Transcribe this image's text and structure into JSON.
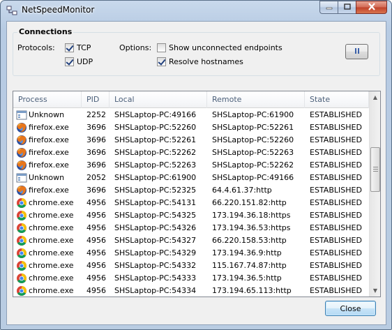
{
  "window": {
    "title": "NetSpeedMonitor"
  },
  "connections": {
    "group_title": "Connections",
    "protocols_label": "Protocols:",
    "tcp": {
      "label": "TCP",
      "checked": true
    },
    "udp": {
      "label": "UDP",
      "checked": true
    },
    "options_label": "Options:",
    "show_unconnected": {
      "label": "Show unconnected endpoints",
      "checked": false
    },
    "resolve_hostnames": {
      "label": "Resolve hostnames",
      "checked": true
    },
    "pause_icon": "pause-icon"
  },
  "table": {
    "columns": [
      "Process",
      "PID",
      "Local",
      "Remote",
      "State"
    ],
    "rows": [
      {
        "icon": "unknown-process-icon",
        "process": "Unknown",
        "pid": "2252",
        "local": "SHSLaptop-PC:49166",
        "remote": "SHSLaptop-PC:61900",
        "state": "ESTABLISHED"
      },
      {
        "icon": "firefox-icon",
        "process": "firefox.exe",
        "pid": "3696",
        "local": "SHSLaptop-PC:52260",
        "remote": "SHSLaptop-PC:52261",
        "state": "ESTABLISHED"
      },
      {
        "icon": "firefox-icon",
        "process": "firefox.exe",
        "pid": "3696",
        "local": "SHSLaptop-PC:52261",
        "remote": "SHSLaptop-PC:52260",
        "state": "ESTABLISHED"
      },
      {
        "icon": "firefox-icon",
        "process": "firefox.exe",
        "pid": "3696",
        "local": "SHSLaptop-PC:52262",
        "remote": "SHSLaptop-PC:52263",
        "state": "ESTABLISHED"
      },
      {
        "icon": "firefox-icon",
        "process": "firefox.exe",
        "pid": "3696",
        "local": "SHSLaptop-PC:52263",
        "remote": "SHSLaptop-PC:52262",
        "state": "ESTABLISHED"
      },
      {
        "icon": "unknown-process-icon",
        "process": "Unknown",
        "pid": "2052",
        "local": "SHSLaptop-PC:61900",
        "remote": "SHSLaptop-PC:49166",
        "state": "ESTABLISHED"
      },
      {
        "icon": "firefox-icon",
        "process": "firefox.exe",
        "pid": "3696",
        "local": "SHSLaptop-PC:52325",
        "remote": "64.4.61.37:http",
        "state": "ESTABLISHED"
      },
      {
        "icon": "chrome-icon",
        "process": "chrome.exe",
        "pid": "4956",
        "local": "SHSLaptop-PC:54131",
        "remote": "66.220.151.82:http",
        "state": "ESTABLISHED"
      },
      {
        "icon": "chrome-icon",
        "process": "chrome.exe",
        "pid": "4956",
        "local": "SHSLaptop-PC:54325",
        "remote": "173.194.36.18:https",
        "state": "ESTABLISHED"
      },
      {
        "icon": "chrome-icon",
        "process": "chrome.exe",
        "pid": "4956",
        "local": "SHSLaptop-PC:54326",
        "remote": "173.194.36.53:https",
        "state": "ESTABLISHED"
      },
      {
        "icon": "chrome-icon",
        "process": "chrome.exe",
        "pid": "4956",
        "local": "SHSLaptop-PC:54327",
        "remote": "66.220.158.53:http",
        "state": "ESTABLISHED"
      },
      {
        "icon": "chrome-icon",
        "process": "chrome.exe",
        "pid": "4956",
        "local": "SHSLaptop-PC:54329",
        "remote": "173.194.36.9:http",
        "state": "ESTABLISHED"
      },
      {
        "icon": "chrome-icon",
        "process": "chrome.exe",
        "pid": "4956",
        "local": "SHSLaptop-PC:54332",
        "remote": "115.167.74.87:http",
        "state": "ESTABLISHED"
      },
      {
        "icon": "chrome-icon",
        "process": "chrome.exe",
        "pid": "4956",
        "local": "SHSLaptop-PC:54333",
        "remote": "173.194.36.5:http",
        "state": "ESTABLISHED"
      },
      {
        "icon": "chrome-icon",
        "process": "chrome.exe",
        "pid": "4956",
        "local": "SHSLaptop-PC:54334",
        "remote": "173.194.65.113:http",
        "state": "ESTABLISHED"
      }
    ]
  },
  "footer": {
    "close_label": "Close"
  }
}
